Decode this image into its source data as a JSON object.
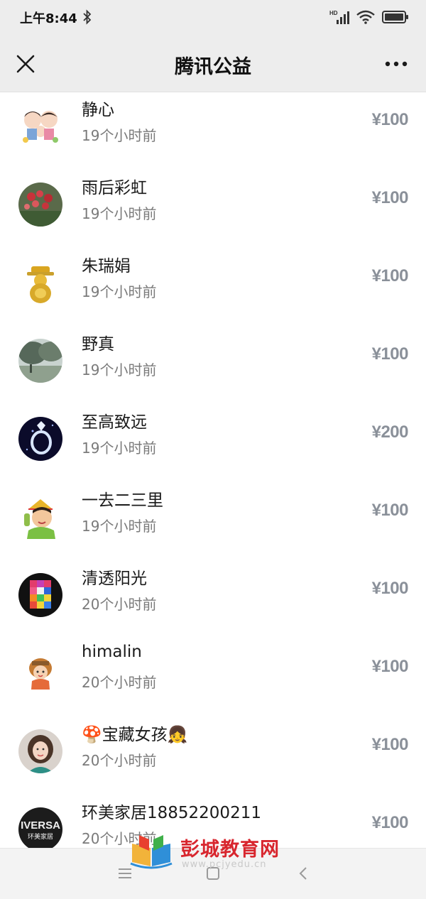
{
  "status_bar": {
    "time": "上午8:44",
    "network_badge": "HD"
  },
  "header": {
    "title": "腾讯公益"
  },
  "donors": [
    {
      "name": "静心",
      "time": "19个小时前",
      "amount": "¥100",
      "avatar": "couple-cartoon-avatar"
    },
    {
      "name": "雨后彩虹",
      "time": "19个小时前",
      "amount": "¥100",
      "avatar": "roses-photo-avatar"
    },
    {
      "name": "朱瑞娟",
      "time": "19个小时前",
      "amount": "¥100",
      "avatar": "golden-figurine-avatar"
    },
    {
      "name": "野真",
      "time": "19个小时前",
      "amount": "¥100",
      "avatar": "park-photo-avatar"
    },
    {
      "name": "至高致远",
      "time": "19个小时前",
      "amount": "¥200",
      "avatar": "diamond-ring-avatar"
    },
    {
      "name": "一去二三里",
      "time": "19个小时前",
      "amount": "¥100",
      "avatar": "cartoon-man-avatar"
    },
    {
      "name": "清透阳光",
      "time": "20个小时前",
      "amount": "¥100",
      "avatar": "color-blocks-avatar"
    },
    {
      "name": "himalin",
      "time": "20个小时前",
      "amount": "¥100",
      "avatar": "cartoon-girl-avatar"
    },
    {
      "name": "🍄宝藏女孩👧",
      "time": "20个小时前",
      "amount": "¥100",
      "avatar": "woman-photo-avatar"
    },
    {
      "name": "环美家居18852200211",
      "time": "20个小时前",
      "amount": "¥100",
      "avatar": "universal-logo-avatar"
    }
  ],
  "avatar_text": {
    "universal_logo_top": "IVERSA",
    "universal_logo_bottom": "环美家居"
  },
  "watermark": {
    "text": "彭城教育网",
    "url": "www.pcjyedu.cn"
  },
  "colors": {
    "header_bg": "#ededed",
    "amount": "#8a9099",
    "secondary_text": "#7a7a7a",
    "watermark_red": "#d8262e"
  }
}
